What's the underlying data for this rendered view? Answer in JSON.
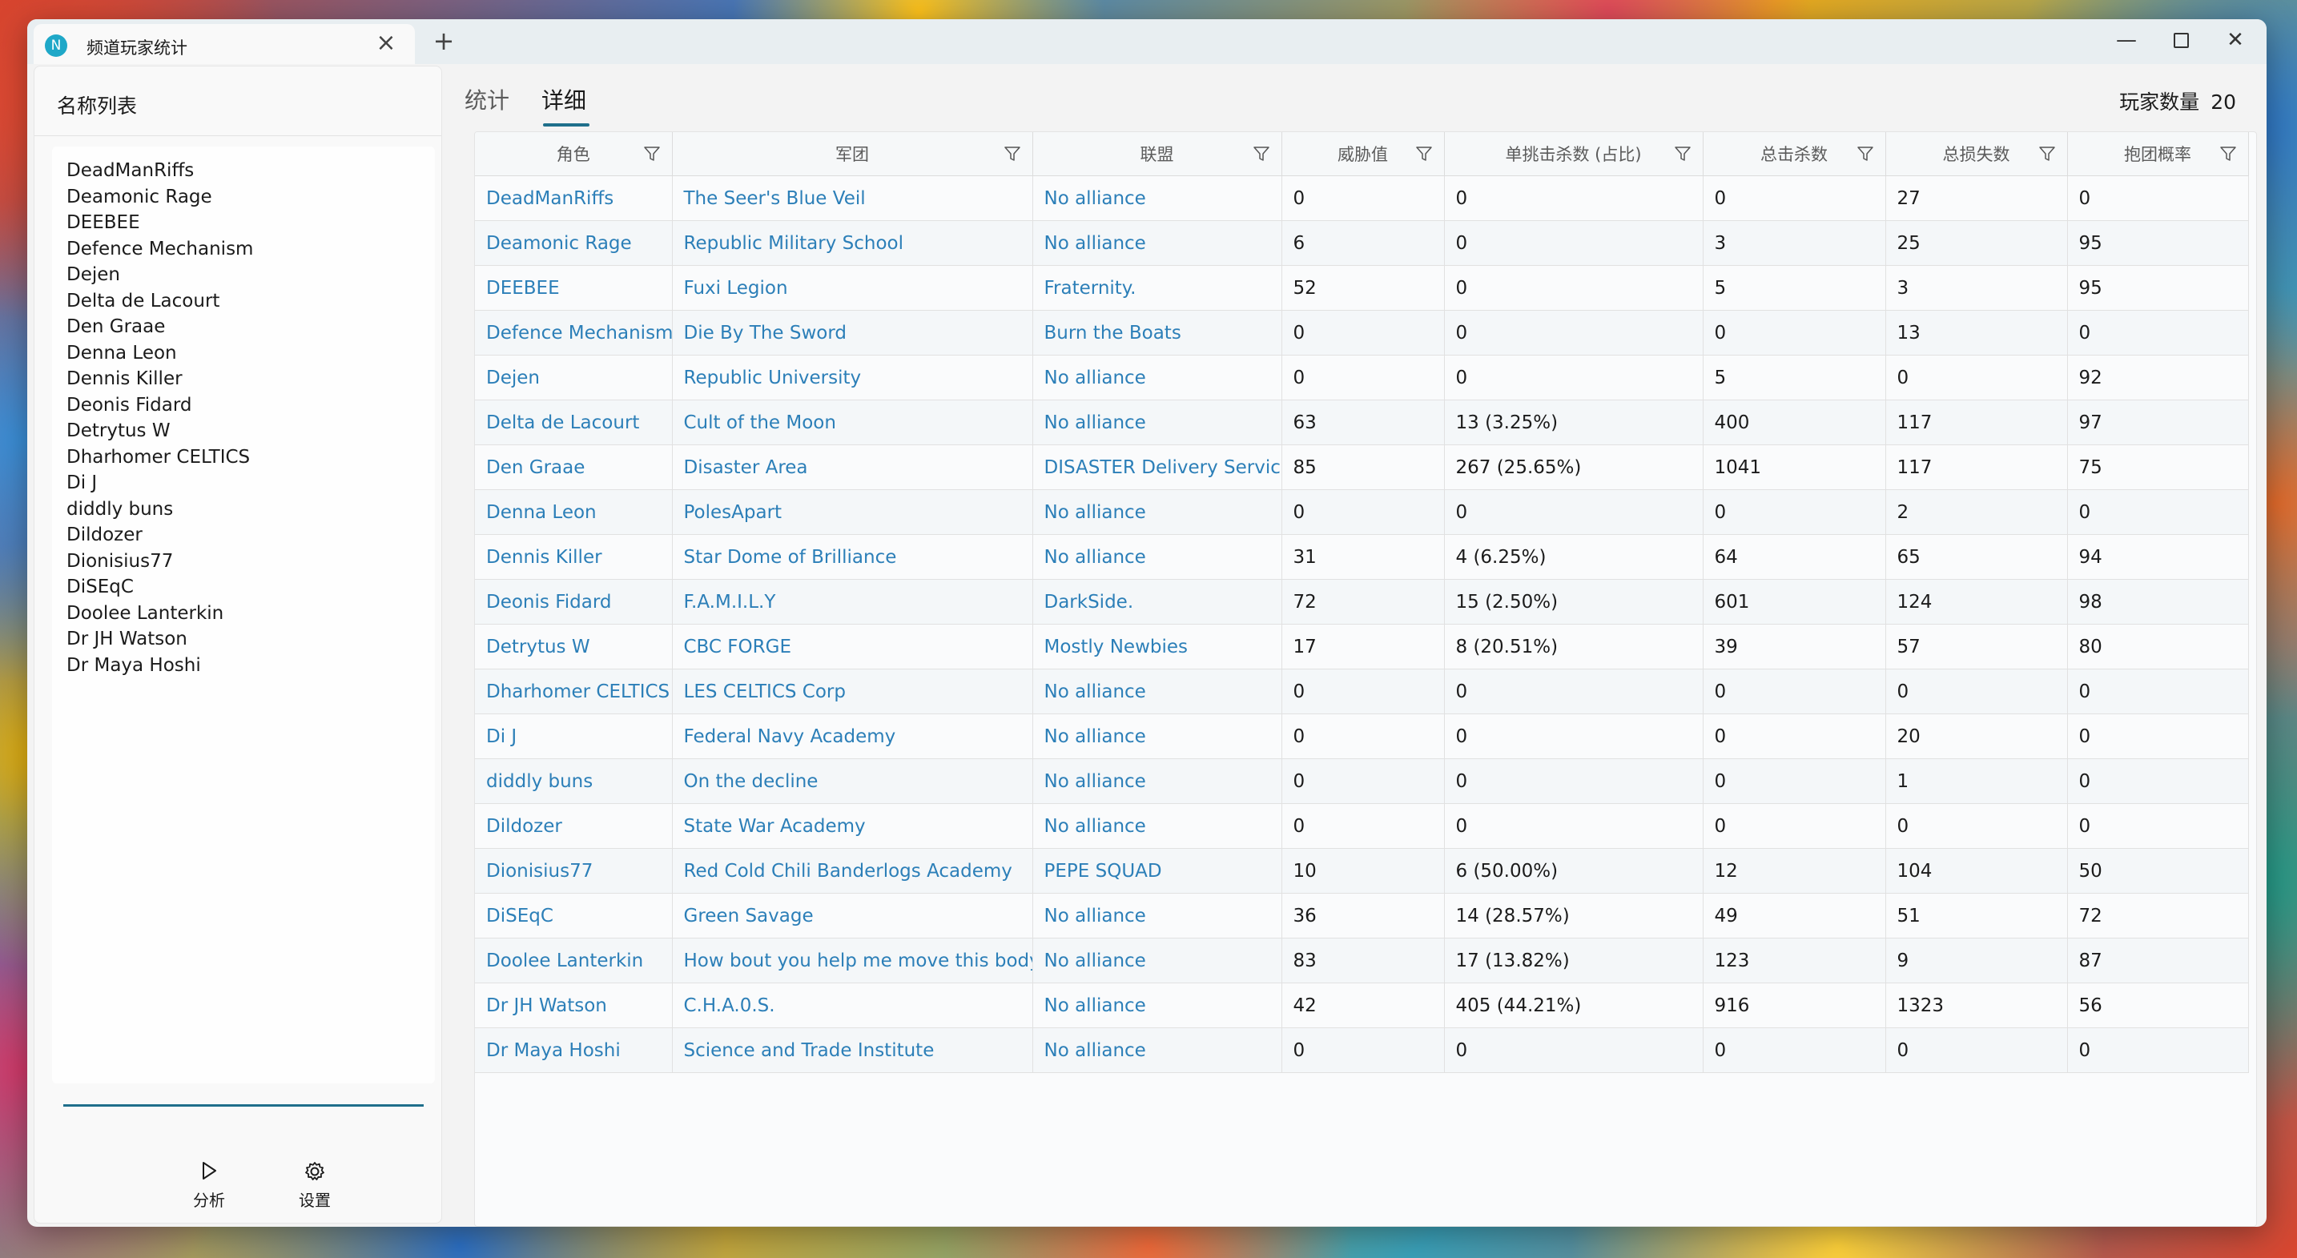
{
  "window": {
    "tab_title": "频道玩家统计",
    "app_icon_letter": "N",
    "tab_close": "×",
    "new_tab": "+",
    "min": "—",
    "close": "✕"
  },
  "sidebar": {
    "header": "名称列表",
    "names": [
      "DeadManRiffs",
      "Deamonic Rage",
      "DEEBEE",
      "Defence Mechanism",
      "Dejen",
      "Delta de Lacourt",
      "Den Graae",
      "Denna Leon",
      "Dennis Killer",
      "Deonis Fidard",
      "Detrytus W",
      "Dharhomer CELTICS",
      "Di J",
      "diddly buns",
      "Dildozer",
      "Dionisius77",
      "DiSEqC",
      "Doolee Lanterkin",
      "Dr JH Watson",
      "Dr Maya Hoshi"
    ],
    "analyze_label": "分析",
    "settings_label": "设置",
    "analyze_icon": "play-icon",
    "settings_icon": "gear-icon"
  },
  "main": {
    "tabs": [
      "统计",
      "详细"
    ],
    "active_tab": "详细",
    "count_label": "玩家数量",
    "count_value": "20",
    "accent_color": "#1f6f8b",
    "link_color": "#2c7fb8"
  },
  "table": {
    "columns": [
      "角色",
      "军团",
      "联盟",
      "威胁值",
      "单挑击杀数 (占比)",
      "总击杀数",
      "总损失数",
      "抱团概率"
    ],
    "rows": [
      [
        "DeadManRiffs",
        "The Seer's Blue Veil",
        "No alliance",
        "0",
        "0",
        "0",
        "27",
        "0"
      ],
      [
        "Deamonic Rage",
        "Republic Military School",
        "No alliance",
        "6",
        "0",
        "3",
        "25",
        "95"
      ],
      [
        "DEEBEE",
        "Fuxi Legion",
        "Fraternity.",
        "52",
        "0",
        "5",
        "3",
        "95"
      ],
      [
        "Defence Mechanism",
        "Die By The Sword",
        "Burn the Boats",
        "0",
        "0",
        "0",
        "13",
        "0"
      ],
      [
        "Dejen",
        "Republic University",
        "No alliance",
        "0",
        "0",
        "5",
        "0",
        "92"
      ],
      [
        "Delta de Lacourt",
        "Cult of the Moon",
        "No alliance",
        "63",
        "13 (3.25%)",
        "400",
        "117",
        "97"
      ],
      [
        "Den Graae",
        "Disaster Area",
        "DISASTER Delivery Service",
        "85",
        "267 (25.65%)",
        "1041",
        "117",
        "75"
      ],
      [
        "Denna Leon",
        "PolesApart",
        "No alliance",
        "0",
        "0",
        "0",
        "2",
        "0"
      ],
      [
        "Dennis Killer",
        "Star Dome of Brilliance",
        "No alliance",
        "31",
        "4 (6.25%)",
        "64",
        "65",
        "94"
      ],
      [
        "Deonis Fidard",
        "F.A.M.I.L.Y",
        "DarkSide.",
        "72",
        "15 (2.50%)",
        "601",
        "124",
        "98"
      ],
      [
        "Detrytus W",
        "CBC FORGE",
        "Mostly Newbies",
        "17",
        "8 (20.51%)",
        "39",
        "57",
        "80"
      ],
      [
        "Dharhomer CELTICS",
        "LES CELTICS Corp",
        "No alliance",
        "0",
        "0",
        "0",
        "0",
        "0"
      ],
      [
        "Di J",
        "Federal Navy Academy",
        "No alliance",
        "0",
        "0",
        "0",
        "20",
        "0"
      ],
      [
        "diddly buns",
        "On the decline",
        "No alliance",
        "0",
        "0",
        "0",
        "1",
        "0"
      ],
      [
        "Dildozer",
        "State War Academy",
        "No alliance",
        "0",
        "0",
        "0",
        "0",
        "0"
      ],
      [
        "Dionisius77",
        "Red Cold Chili Banderlogs Academy",
        "PEPE SQUAD",
        "10",
        "6 (50.00%)",
        "12",
        "104",
        "50"
      ],
      [
        "DiSEqC",
        "Green Savage",
        "No alliance",
        "36",
        "14 (28.57%)",
        "49",
        "51",
        "72"
      ],
      [
        "Doolee Lanterkin",
        "How bout you help me move this body",
        "No alliance",
        "83",
        "17 (13.82%)",
        "123",
        "9",
        "87"
      ],
      [
        "Dr JH Watson",
        "C.H.A.0.S.",
        "No alliance",
        "42",
        "405 (44.21%)",
        "916",
        "1323",
        "56"
      ],
      [
        "Dr Maya Hoshi",
        "Science and Trade Institute",
        "No alliance",
        "0",
        "0",
        "0",
        "0",
        "0"
      ]
    ]
  }
}
